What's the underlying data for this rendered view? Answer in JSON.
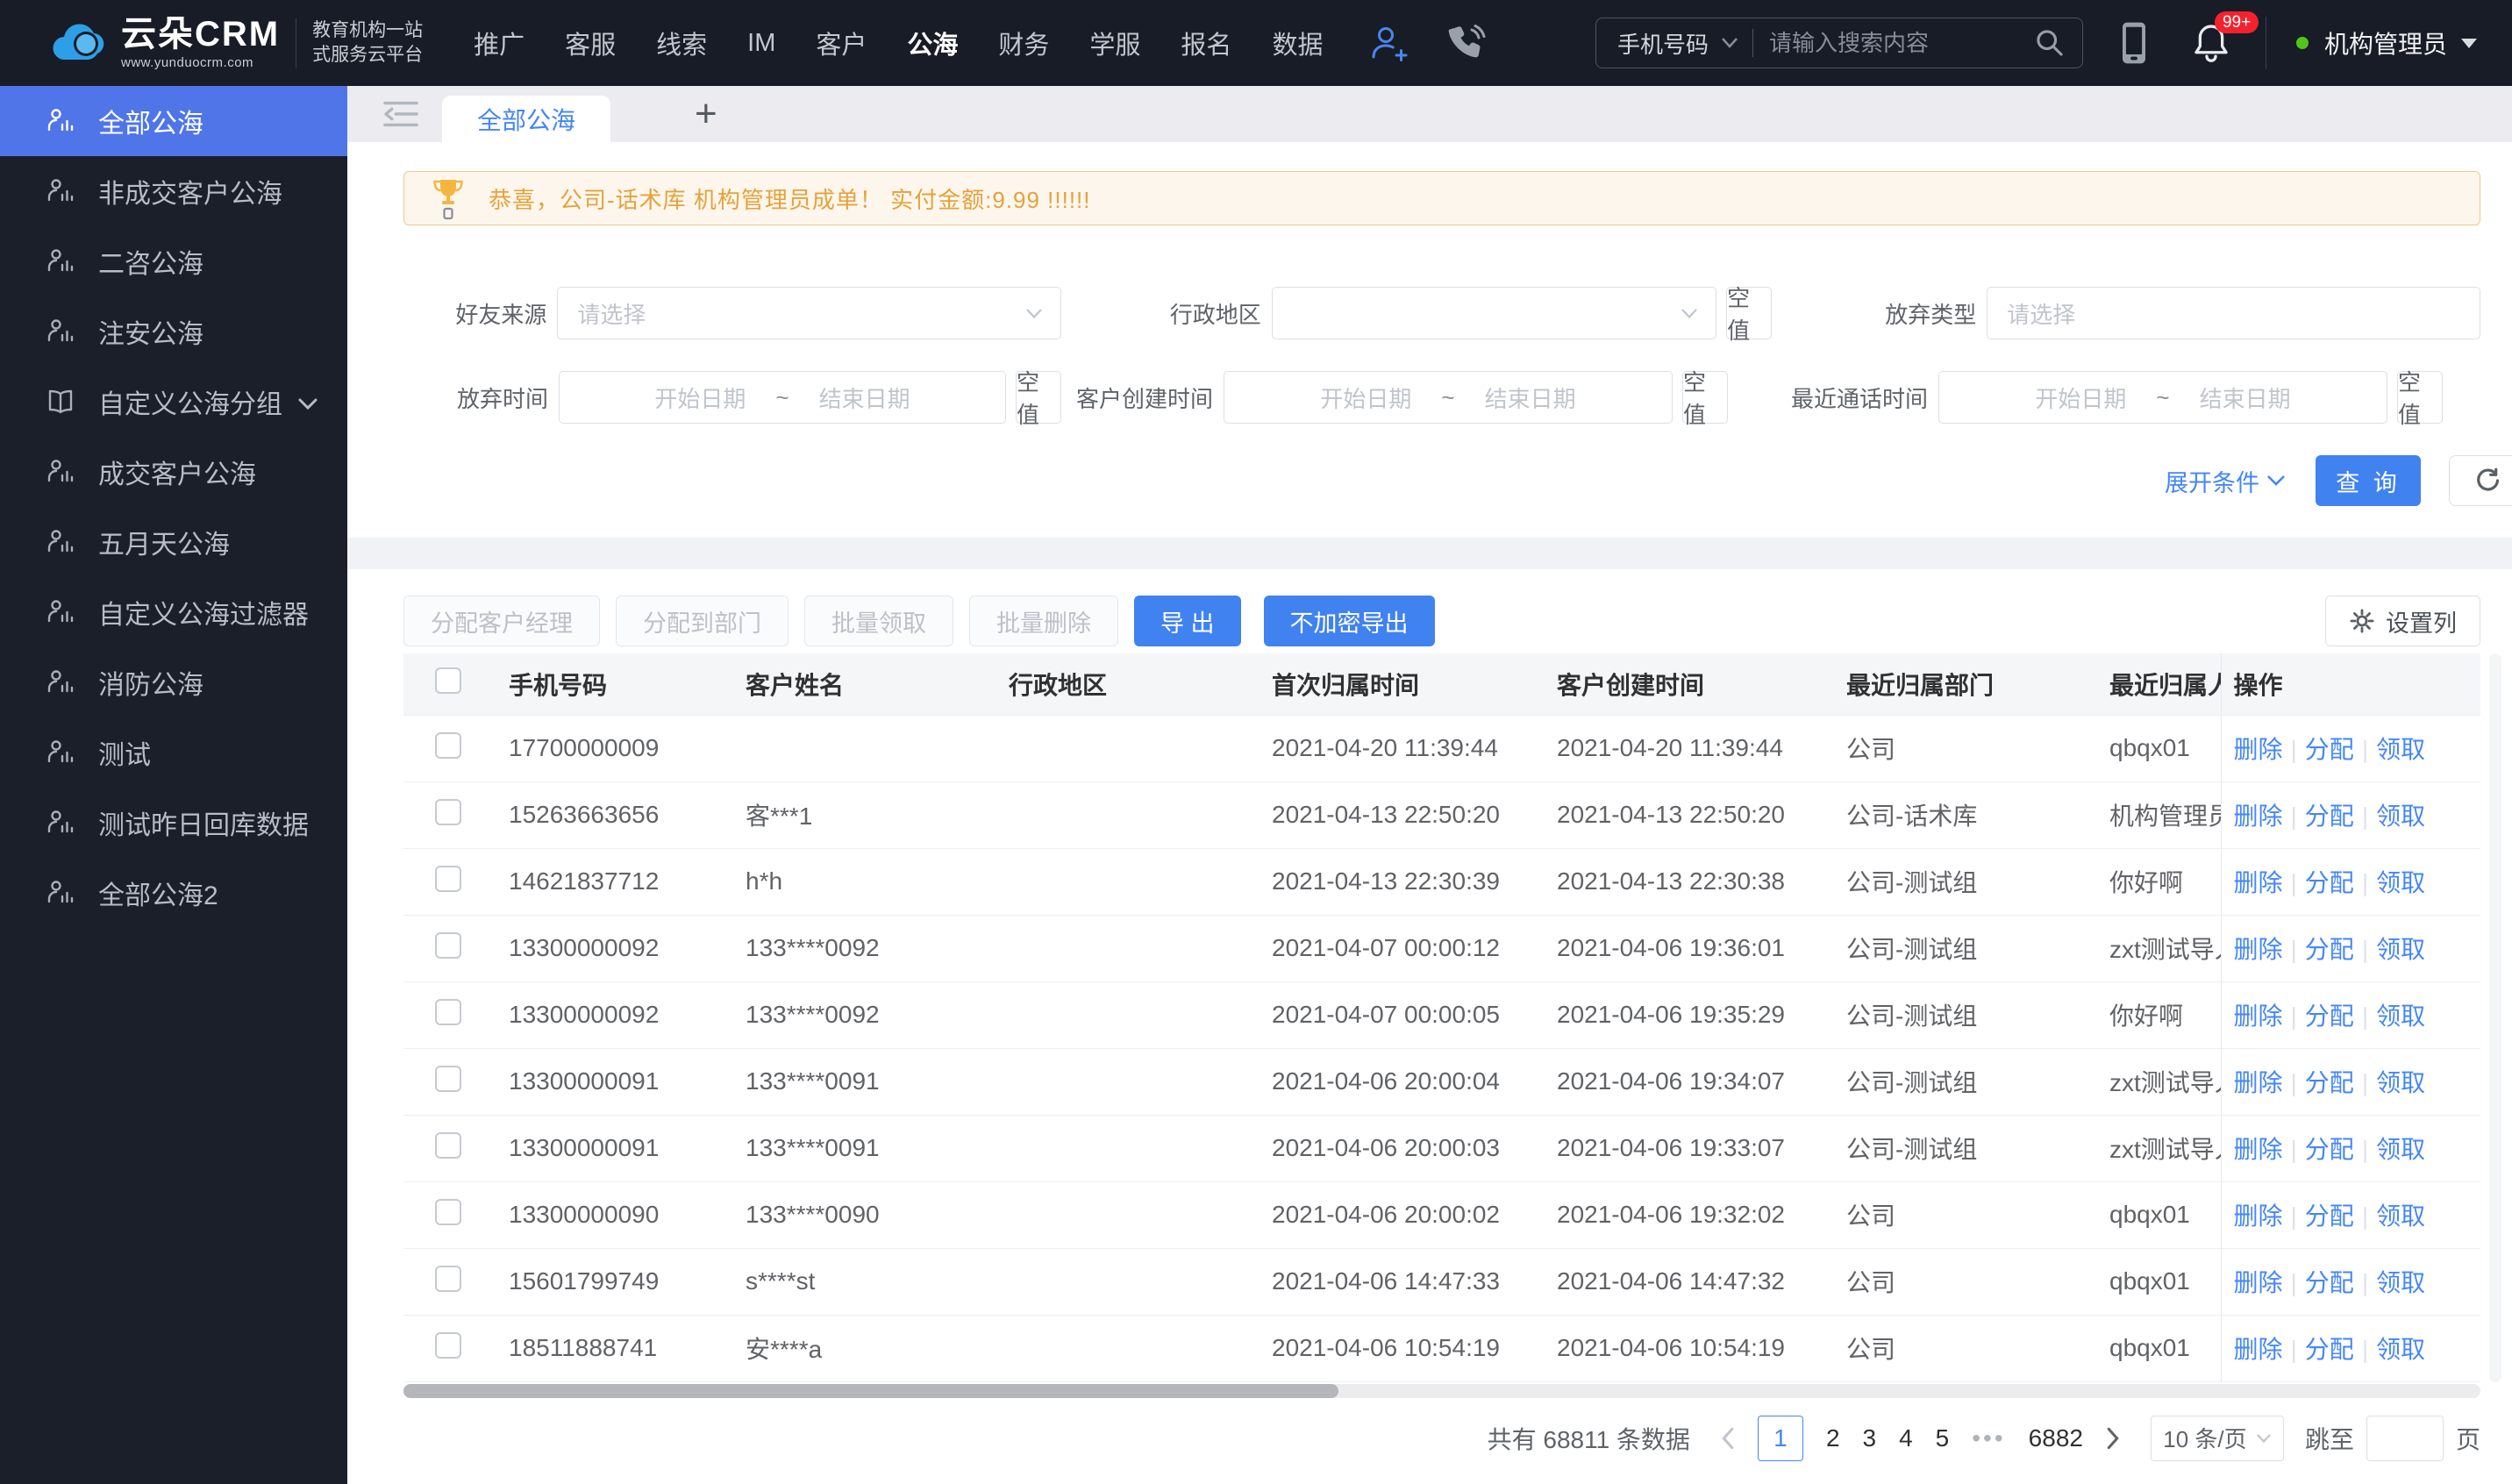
{
  "colors": {
    "accent": "#4486f7",
    "primary_button": "#4082f0",
    "sidebar_active": "#4f75e8",
    "alert_bg": "#fdf6ec",
    "alert_border": "#f0c78a",
    "alert_text": "#e6a23c",
    "badge_red": "#f5222d",
    "status_green": "#52c41a",
    "dark_bg": "#181c26"
  },
  "topbar": {
    "logo": {
      "brand": "云朵CRM",
      "site": "www.yunduocrm.com",
      "tagline1": "教育机构一站",
      "tagline2": "式服务云平台"
    },
    "nav": [
      {
        "label": "推广"
      },
      {
        "label": "客服"
      },
      {
        "label": "线索"
      },
      {
        "label": "IM"
      },
      {
        "label": "客户"
      },
      {
        "label": "公海"
      },
      {
        "label": "财务"
      },
      {
        "label": "学服"
      },
      {
        "label": "报名"
      },
      {
        "label": "数据"
      }
    ],
    "search": {
      "category": "手机号码",
      "placeholder": "请输入搜索内容"
    },
    "badge": "99+",
    "user": {
      "name": "机构管理员"
    }
  },
  "sidebar": {
    "items": [
      {
        "label": "全部公海"
      },
      {
        "label": "非成交客户公海"
      },
      {
        "label": "二咨公海"
      },
      {
        "label": "注安公海"
      },
      {
        "label": "自定义公海分组"
      },
      {
        "label": "成交客户公海"
      },
      {
        "label": "五月天公海"
      },
      {
        "label": "自定义公海过滤器"
      },
      {
        "label": "消防公海"
      },
      {
        "label": "测试"
      },
      {
        "label": "测试昨日回库数据"
      },
      {
        "label": "全部公海2"
      }
    ]
  },
  "tabs": {
    "active": "全部公海",
    "add_label": "+"
  },
  "alert": {
    "text": "恭喜，公司-话术库  机构管理员成单！  实付金额:9.99 !!!!!!"
  },
  "filters": {
    "friend_source_label": "好友来源",
    "friend_source_placeholder": "请选择",
    "region_label": "行政地区",
    "abandon_type_label": "放弃类型",
    "abandon_type_placeholder": "请选择",
    "abandon_time_label": "放弃时间",
    "create_time_label": "客户创建时间",
    "last_call_label": "最近通话时间",
    "date_start": "开始日期",
    "date_tilde": "~",
    "date_end": "结束日期",
    "empty_value": "空值",
    "expand_label": "展开条件",
    "query_label": "查 询"
  },
  "toolbar": {
    "assign_manager": "分配客户经理",
    "assign_dept": "分配到部门",
    "batch_claim": "批量领取",
    "batch_delete": "批量删除",
    "export": "导 出",
    "export_plain": "不加密导出",
    "set_columns": "设置列"
  },
  "table": {
    "columns": [
      "手机号码",
      "客户姓名",
      "行政地区",
      "首次归属时间",
      "客户创建时间",
      "最近归属部门",
      "最近归属人",
      "操作"
    ],
    "actions": {
      "delete": "删除",
      "assign": "分配",
      "claim": "领取"
    },
    "rows": [
      {
        "phone": "17700000009",
        "name": "",
        "region": "",
        "first_time": "2021-04-20 11:39:44",
        "create_time": "2021-04-20 11:39:44",
        "dept": "公司",
        "owner": "qbqx01"
      },
      {
        "phone": "15263663656",
        "name": "客***1",
        "region": "",
        "first_time": "2021-04-13 22:50:20",
        "create_time": "2021-04-13 22:50:20",
        "dept": "公司-话术库",
        "owner": "机构管理员"
      },
      {
        "phone": "14621837712",
        "name": "h*h",
        "region": "",
        "first_time": "2021-04-13 22:30:39",
        "create_time": "2021-04-13 22:30:38",
        "dept": "公司-测试组",
        "owner": "你好啊"
      },
      {
        "phone": "13300000092",
        "name": "133****0092",
        "region": "",
        "first_time": "2021-04-07 00:00:12",
        "create_time": "2021-04-06 19:36:01",
        "dept": "公司-测试组",
        "owner": "zxt测试导入"
      },
      {
        "phone": "13300000092",
        "name": "133****0092",
        "region": "",
        "first_time": "2021-04-07 00:00:05",
        "create_time": "2021-04-06 19:35:29",
        "dept": "公司-测试组",
        "owner": "你好啊"
      },
      {
        "phone": "13300000091",
        "name": "133****0091",
        "region": "",
        "first_time": "2021-04-06 20:00:04",
        "create_time": "2021-04-06 19:34:07",
        "dept": "公司-测试组",
        "owner": "zxt测试导入"
      },
      {
        "phone": "13300000091",
        "name": "133****0091",
        "region": "",
        "first_time": "2021-04-06 20:00:03",
        "create_time": "2021-04-06 19:33:07",
        "dept": "公司-测试组",
        "owner": "zxt测试导入"
      },
      {
        "phone": "13300000090",
        "name": "133****0090",
        "region": "",
        "first_time": "2021-04-06 20:00:02",
        "create_time": "2021-04-06 19:32:02",
        "dept": "公司",
        "owner": "qbqx01"
      },
      {
        "phone": "15601799749",
        "name": "s****st",
        "region": "",
        "first_time": "2021-04-06 14:47:33",
        "create_time": "2021-04-06 14:47:32",
        "dept": "公司",
        "owner": "qbqx01"
      },
      {
        "phone": "18511888741",
        "name": "安****a",
        "region": "",
        "first_time": "2021-04-06 10:54:19",
        "create_time": "2021-04-06 10:54:19",
        "dept": "公司",
        "owner": "qbqx01"
      }
    ]
  },
  "pagination": {
    "total": "共有 68811 条数据",
    "page1": "1",
    "page2": "2",
    "page3": "3",
    "page4": "4",
    "page5": "5",
    "ellipsis": "•••",
    "last": "6882",
    "size": "10 条/页",
    "jump": "跳至",
    "page_unit": "页"
  }
}
